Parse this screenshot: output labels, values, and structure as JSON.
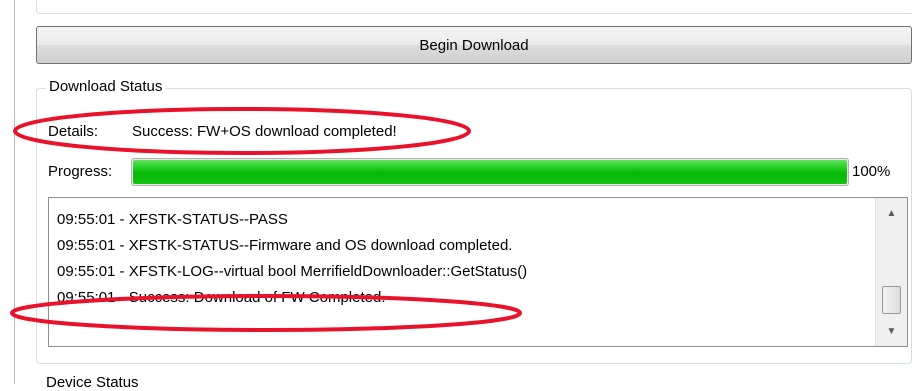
{
  "colors": {
    "progress_fill": "#06b806",
    "annotation": "#e8132b",
    "group_border": "#d5dfe5"
  },
  "download_button": {
    "label": "Begin Download"
  },
  "download_status": {
    "title": "Download Status",
    "details_label": "Details:",
    "details_value": "Success: FW+OS download completed!",
    "progress_label": "Progress:",
    "progress_percent": 100,
    "progress_text": "100%"
  },
  "log": {
    "lines": [
      "09:55:01 - XFSTK-STATUS--PASS",
      "09:55:01 - XFSTK-STATUS--Firmware and OS download completed.",
      "09:55:01 - XFSTK-LOG--virtual bool MerrifieldDownloader::GetStatus()",
      "09:55:01 - Success: Download of FW Completed."
    ],
    "scroll_up_icon": "triangle-up-icon",
    "scroll_down_icon": "triangle-down-icon"
  },
  "bottom_section": {
    "title": "Device Status"
  }
}
